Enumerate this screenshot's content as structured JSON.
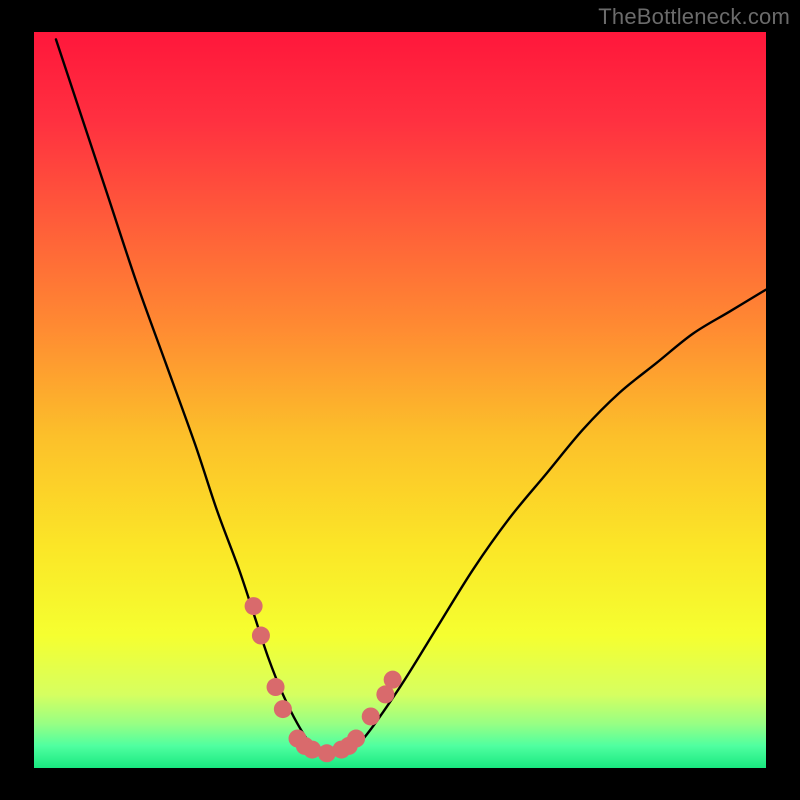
{
  "watermark": "TheBottleneck.com",
  "plot": {
    "inner_left": 34,
    "inner_top": 32,
    "inner_width": 732,
    "inner_height": 736
  },
  "gradient": {
    "stops": [
      {
        "offset": 0.0,
        "color": "#ff173b"
      },
      {
        "offset": 0.12,
        "color": "#ff3040"
      },
      {
        "offset": 0.25,
        "color": "#ff5a3a"
      },
      {
        "offset": 0.4,
        "color": "#ff8a32"
      },
      {
        "offset": 0.55,
        "color": "#fcc02a"
      },
      {
        "offset": 0.7,
        "color": "#fbe627"
      },
      {
        "offset": 0.82,
        "color": "#f5ff30"
      },
      {
        "offset": 0.9,
        "color": "#d6ff60"
      },
      {
        "offset": 0.94,
        "color": "#97ff84"
      },
      {
        "offset": 0.97,
        "color": "#4fffa0"
      },
      {
        "offset": 1.0,
        "color": "#19e880"
      }
    ]
  },
  "chart_data": {
    "type": "line",
    "title": "",
    "xlabel": "",
    "ylabel": "",
    "xlim": [
      0,
      100
    ],
    "ylim": [
      0,
      100
    ],
    "series": [
      {
        "name": "bottleneck-curve",
        "x": [
          3,
          6,
          10,
          14,
          18,
          22,
          25,
          28,
          30,
          32,
          34,
          36,
          38,
          40,
          42,
          45,
          50,
          55,
          60,
          65,
          70,
          75,
          80,
          85,
          90,
          95,
          100
        ],
        "y": [
          99,
          90,
          78,
          66,
          55,
          44,
          35,
          27,
          21,
          15,
          10,
          6,
          3,
          2,
          2,
          4,
          11,
          19,
          27,
          34,
          40,
          46,
          51,
          55,
          59,
          62,
          65
        ]
      }
    ],
    "markers": {
      "name": "highlight-dots",
      "color": "#d96a6c",
      "radius_px": 9,
      "points": [
        {
          "x": 30,
          "y": 22
        },
        {
          "x": 31,
          "y": 18
        },
        {
          "x": 33,
          "y": 11
        },
        {
          "x": 34,
          "y": 8
        },
        {
          "x": 36,
          "y": 4
        },
        {
          "x": 37,
          "y": 3
        },
        {
          "x": 38,
          "y": 2.5
        },
        {
          "x": 40,
          "y": 2
        },
        {
          "x": 42,
          "y": 2.5
        },
        {
          "x": 43,
          "y": 3
        },
        {
          "x": 44,
          "y": 4
        },
        {
          "x": 46,
          "y": 7
        },
        {
          "x": 48,
          "y": 10
        },
        {
          "x": 49,
          "y": 12
        }
      ]
    }
  }
}
